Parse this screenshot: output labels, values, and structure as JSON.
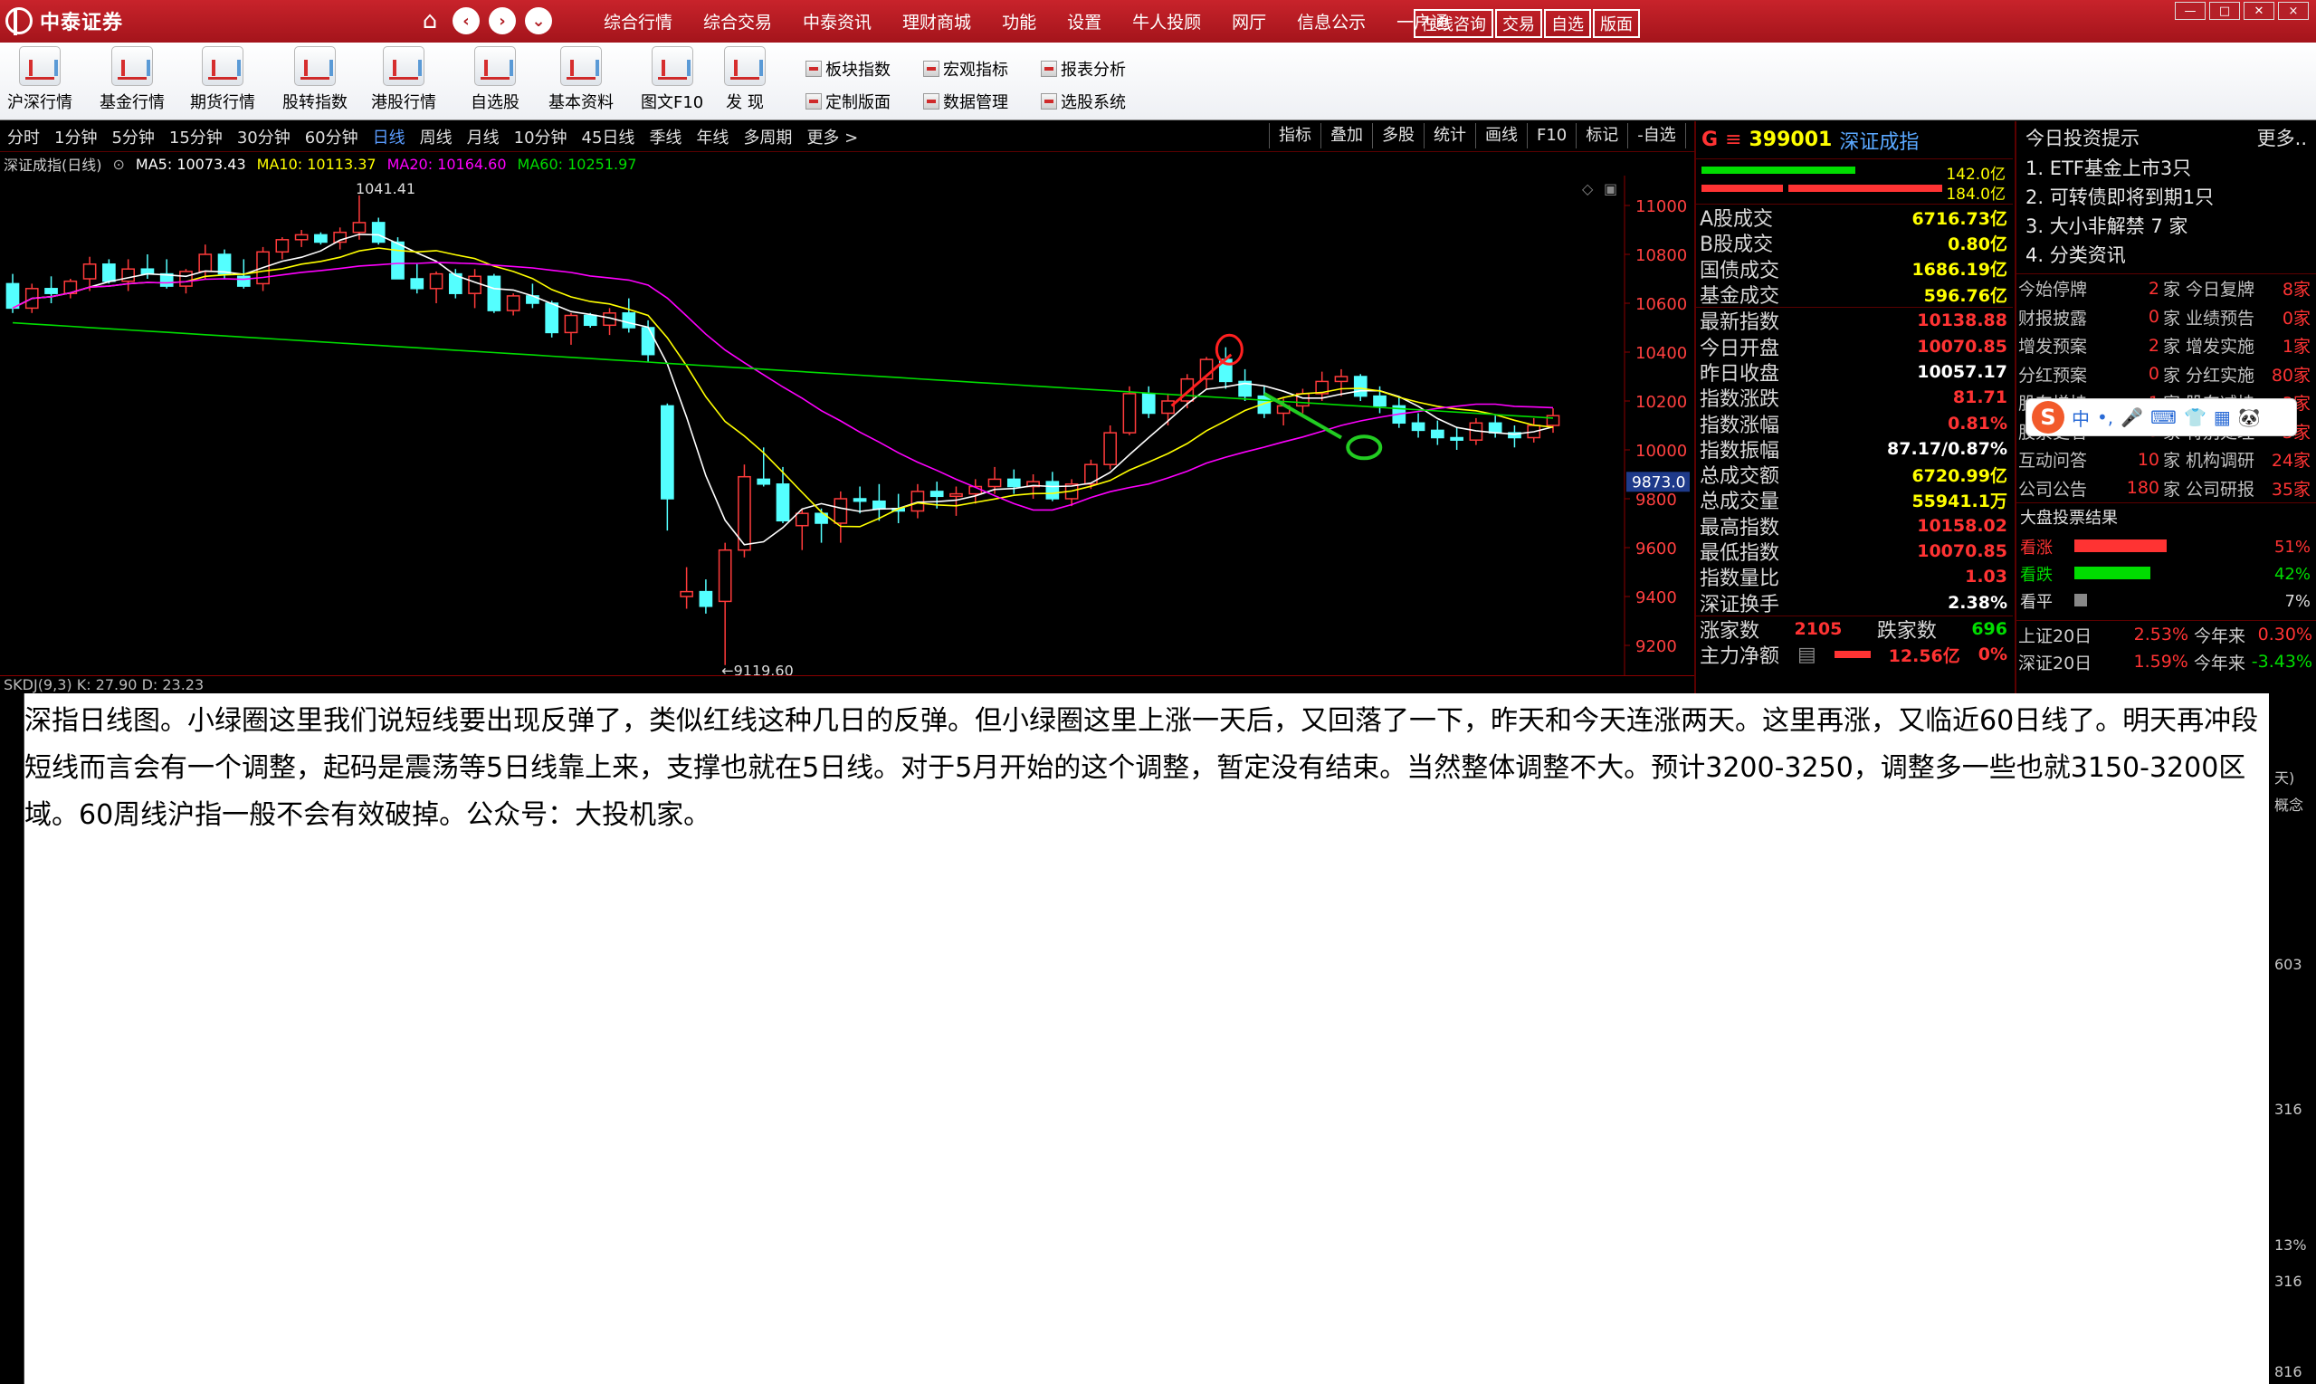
{
  "titlebar": {
    "app_name": "中泰证券",
    "menu": [
      "综合行情",
      "综合交易",
      "中泰资讯",
      "理财商城",
      "功能",
      "设置",
      "牛人投顾",
      "网厅",
      "信息公示",
      "一户通"
    ],
    "buttons": [
      "在线咨询",
      "交易",
      "自选",
      "版面"
    ],
    "window_controls": [
      "—",
      "□",
      "✕",
      "×"
    ]
  },
  "toolbar": {
    "tools": [
      "沪深行情",
      "基金行情",
      "期货行情",
      "股转指数",
      "港股行情",
      "自选股",
      "基本资料",
      "图文F10",
      "发  现"
    ],
    "small_tools": [
      "板块指数",
      "宏观指标",
      "报表分析",
      "定制版面",
      "数据管理",
      "选股系统"
    ]
  },
  "periods": [
    "分时",
    "1分钟",
    "5分钟",
    "15分钟",
    "30分钟",
    "60分钟",
    "日线",
    "周线",
    "月线",
    "10分钟",
    "45日线",
    "季线",
    "年线",
    "多周期",
    "更多 >"
  ],
  "active_period": "日线",
  "right_tools": [
    "指标",
    "叠加",
    "多股",
    "统计",
    "画线",
    "F10",
    "标记",
    "-自选",
    "返回"
  ],
  "ma_row": {
    "title": "深证成指(日线)",
    "ma5": "MA5: 10073.43",
    "ma10": "MA10: 10113.37",
    "ma20": "MA20: 10164.60",
    "ma60": "MA60: 10251.97"
  },
  "indicator_row": "SKDJ(9,3)  K: 27.90  D: 23.23",
  "chart_data": {
    "type": "candlestick",
    "title": "深证成指(日线)",
    "ylim": [
      9100,
      11100
    ],
    "y_ticks": [
      9200,
      9400,
      9600,
      9800,
      10000,
      10200,
      10400,
      10600,
      10800,
      11000
    ],
    "high_label": "1041.41",
    "low_label": "←9119.60",
    "current_price_tag": "9873.0",
    "series_colors": {
      "up": "#ff3b3b",
      "down": "#54ffff",
      "ma5": "#ffffff",
      "ma10": "#ffff00",
      "ma20": "#ff00ff",
      "ma60": "#00dd00"
    },
    "candles": [
      [
        10680,
        10720,
        10560,
        10580
      ],
      [
        10580,
        10680,
        10560,
        10660
      ],
      [
        10660,
        10710,
        10600,
        10640
      ],
      [
        10640,
        10700,
        10620,
        10690
      ],
      [
        10700,
        10790,
        10650,
        10760
      ],
      [
        10760,
        10780,
        10680,
        10690
      ],
      [
        10690,
        10780,
        10650,
        10740
      ],
      [
        10740,
        10800,
        10700,
        10720
      ],
      [
        10720,
        10780,
        10660,
        10670
      ],
      [
        10670,
        10740,
        10640,
        10730
      ],
      [
        10730,
        10840,
        10700,
        10800
      ],
      [
        10800,
        10820,
        10700,
        10720
      ],
      [
        10710,
        10780,
        10660,
        10670
      ],
      [
        10680,
        10830,
        10650,
        10810
      ],
      [
        10810,
        10870,
        10780,
        10860
      ],
      [
        10860,
        10900,
        10830,
        10880
      ],
      [
        10880,
        10890,
        10840,
        10850
      ],
      [
        10850,
        10910,
        10820,
        10890
      ],
      [
        10890,
        11041.41,
        10860,
        10930
      ],
      [
        10930,
        10950,
        10840,
        10850
      ],
      [
        10850,
        10870,
        10700,
        10700
      ],
      [
        10700,
        10760,
        10640,
        10660
      ],
      [
        10660,
        10730,
        10600,
        10720
      ],
      [
        10720,
        10740,
        10620,
        10640
      ],
      [
        10640,
        10740,
        10580,
        10710
      ],
      [
        10710,
        10720,
        10560,
        10570
      ],
      [
        10570,
        10640,
        10550,
        10630
      ],
      [
        10630,
        10680,
        10580,
        10600
      ],
      [
        10600,
        10610,
        10460,
        10480
      ],
      [
        10480,
        10560,
        10430,
        10550
      ],
      [
        10550,
        10560,
        10500,
        10510
      ],
      [
        10510,
        10580,
        10470,
        10560
      ],
      [
        10560,
        10620,
        10480,
        10500
      ],
      [
        10500,
        10530,
        10360,
        10390
      ],
      [
        10180,
        10190,
        9670,
        9800
      ],
      [
        9400,
        9520,
        9350,
        9420
      ],
      [
        9420,
        9470,
        9330,
        9360
      ],
      [
        9380,
        9620,
        9119.6,
        9590
      ],
      [
        9590,
        9940,
        9560,
        9890
      ],
      [
        9880,
        10010,
        9850,
        9860
      ],
      [
        9860,
        9930,
        9700,
        9710
      ],
      [
        9690,
        9760,
        9590,
        9740
      ],
      [
        9740,
        9760,
        9620,
        9700
      ],
      [
        9700,
        9830,
        9620,
        9800
      ],
      [
        9800,
        9850,
        9740,
        9790
      ],
      [
        9790,
        9860,
        9710,
        9760
      ],
      [
        9760,
        9820,
        9700,
        9750
      ],
      [
        9750,
        9860,
        9720,
        9830
      ],
      [
        9830,
        9870,
        9760,
        9810
      ],
      [
        9810,
        9850,
        9730,
        9820
      ],
      [
        9820,
        9880,
        9780,
        9850
      ],
      [
        9850,
        9930,
        9820,
        9880
      ],
      [
        9880,
        9920,
        9820,
        9850
      ],
      [
        9850,
        9900,
        9800,
        9870
      ],
      [
        9870,
        9910,
        9790,
        9800
      ],
      [
        9800,
        9880,
        9770,
        9860
      ],
      [
        9860,
        9960,
        9840,
        9940
      ],
      [
        9940,
        10100,
        9920,
        10070
      ],
      [
        10070,
        10260,
        10060,
        10230
      ],
      [
        10230,
        10260,
        10130,
        10150
      ],
      [
        10150,
        10230,
        10100,
        10200
      ],
      [
        10200,
        10310,
        10170,
        10290
      ],
      [
        10290,
        10380,
        10250,
        10370
      ],
      [
        10370,
        10420,
        10250,
        10280
      ],
      [
        10280,
        10330,
        10200,
        10220
      ],
      [
        10220,
        10260,
        10130,
        10150
      ],
      [
        10150,
        10210,
        10100,
        10180
      ],
      [
        10180,
        10250,
        10150,
        10230
      ],
      [
        10230,
        10320,
        10200,
        10280
      ],
      [
        10280,
        10330,
        10220,
        10300
      ],
      [
        10300,
        10310,
        10200,
        10220
      ],
      [
        10220,
        10260,
        10150,
        10180
      ],
      [
        10180,
        10220,
        10090,
        10110
      ],
      [
        10110,
        10150,
        10050,
        10080
      ],
      [
        10080,
        10120,
        10020,
        10050
      ],
      [
        10050,
        10090,
        10000,
        10040
      ],
      [
        10040,
        10130,
        10020,
        10110
      ],
      [
        10110,
        10140,
        10050,
        10070
      ],
      [
        10070,
        10100,
        10010,
        10050
      ],
      [
        10050,
        10130,
        10030,
        10100
      ],
      [
        10100,
        10170,
        10070,
        10140
      ]
    ]
  },
  "quote": {
    "badge": "G",
    "code": "399001",
    "name": "深证成指",
    "bar_values": [
      "142.0亿",
      "184.0亿"
    ],
    "rows": [
      {
        "label": "A股成交",
        "value": "6716.73亿",
        "color": "#ffff00"
      },
      {
        "label": "B股成交",
        "value": "0.80亿",
        "color": "#ffff00"
      },
      {
        "label": "国债成交",
        "value": "1686.19亿",
        "color": "#ffff00"
      },
      {
        "label": "基金成交",
        "value": "596.76亿",
        "color": "#ffff00"
      },
      {
        "label": "最新指数",
        "value": "10138.88",
        "color": "#ff3333"
      },
      {
        "label": "今日开盘",
        "value": "10070.85",
        "color": "#ff3333"
      },
      {
        "label": "昨日收盘",
        "value": "10057.17",
        "color": "#ffffff"
      },
      {
        "label": "指数涨跌",
        "value": "81.71",
        "color": "#ff3333"
      },
      {
        "label": "指数涨幅",
        "value": "0.81%",
        "color": "#ff3333"
      },
      {
        "label": "指数振幅",
        "value": "87.17/0.87%",
        "color": "#ffffff"
      },
      {
        "label": "总成交额",
        "value": "6720.99亿",
        "color": "#ffff00"
      },
      {
        "label": "总成交量",
        "value": "55941.1万",
        "color": "#ffff00"
      },
      {
        "label": "最高指数",
        "value": "10158.02",
        "color": "#ff3333"
      },
      {
        "label": "最低指数",
        "value": "10070.85",
        "color": "#ff3333"
      },
      {
        "label": "指数量比",
        "value": "1.03",
        "color": "#ff3333"
      },
      {
        "label": "深证换手",
        "value": "2.38%",
        "color": "#ffffff"
      }
    ],
    "up_label": "涨家数",
    "up_count": "2105",
    "down_label": "跌家数",
    "down_count": "696",
    "flow_label": "主力净额",
    "flow_value": "12.56亿",
    "flow_pct": "0%"
  },
  "info": {
    "title": "今日投资提示",
    "more": "更多..",
    "tips": [
      "1. ETF基金上市3只",
      "2. 可转债即将到期1只",
      "3. 大小非解禁 7 家",
      "4. 分类资讯"
    ],
    "grid": [
      [
        "今始停牌",
        "2",
        "家 今日复牌",
        "8家"
      ],
      [
        "财报披露",
        "0",
        "家 业绩预告",
        "0家"
      ],
      [
        "增发预案",
        "2",
        "家 增发实施",
        "1家"
      ],
      [
        "分红预案",
        "0",
        "家 分红实施",
        "80家"
      ],
      [
        "股东增持",
        "1",
        "家 股东减持",
        "3家"
      ],
      [
        "股票更名",
        "3",
        "家 特别处理",
        "3家"
      ],
      [
        "互动问答",
        "10",
        "家 机构调研",
        "24家"
      ],
      [
        "公司公告",
        "180",
        "家 公司研报",
        "35家"
      ]
    ],
    "vote_title": "大盘投票结果",
    "votes": [
      {
        "label": "看涨",
        "pct": "51%",
        "value": 51,
        "color": "#ff3333"
      },
      {
        "label": "看跌",
        "pct": "42%",
        "value": 42,
        "color": "#00dd00"
      },
      {
        "label": "看平",
        "pct": "7%",
        "value": 7,
        "color": "#888888"
      }
    ],
    "bottom": [
      {
        "label": "上证20日",
        "v1": "2.53%",
        "v1c": "#ff3333",
        "l2": "今年来",
        "v2": "0.30%",
        "v2c": "#ff3333"
      },
      {
        "label": "深证20日",
        "v1": "1.59%",
        "v1c": "#ff3333",
        "l2": "今年来",
        "v2": "-3.43%",
        "v2c": "#00dd00"
      }
    ]
  },
  "ime": {
    "logo": "S",
    "items": [
      "中",
      "•,",
      "🎤",
      "⌨",
      "👕",
      "▦",
      "🐼"
    ]
  },
  "overlay_text": "深指日线图。小绿圈这里我们说短线要出现反弹了，类似红线这种几日的反弹。但小绿圈这里上涨一天后，又回落了一下，昨天和今天连涨两天。这里再涨，又临近60日线了。明天再冲段短线而言会有一个调整，起码是震荡等5日线靠上来，支撑也就在5日线。对于5月开始的这个调整，暂定没有结束。当然整体调整不大。预计3200-3250，调整多一些也就3150-3200区域。60周线沪指一般不会有效破掉。公众号：大投机家。",
  "right_strip": [
    "天)",
    "概念",
    "603",
    "316",
    "13%",
    "316",
    "816"
  ]
}
